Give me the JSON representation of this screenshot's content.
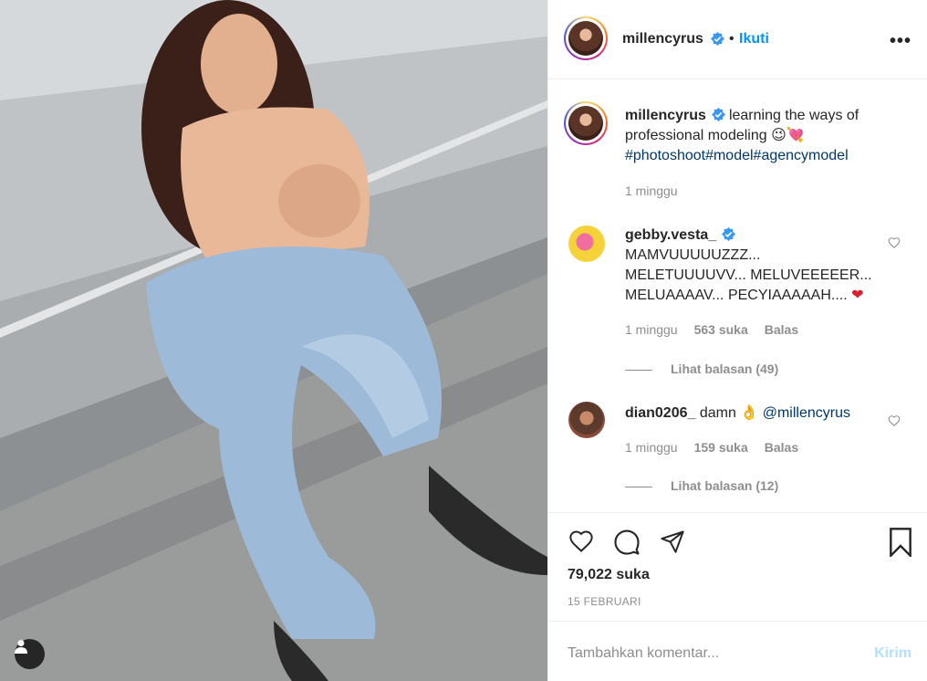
{
  "post": {
    "username": "millencyrus",
    "follow_label": "Ikuti",
    "more_icon": "more-options-icon",
    "separator": "•"
  },
  "caption": {
    "username": "millencyrus",
    "text": "learning the ways of professional modeling",
    "emoji": "😉💘",
    "hashtags": "#photoshoot#model#agencymodel",
    "time": "1 minggu"
  },
  "comments": [
    {
      "username": "gebby.vesta_",
      "verified": true,
      "text": "MAMVUUUUUZZZ... MELETUUUUVV... MELUVEEEEER... MELUAAAAV... PECYIAAAAAH....",
      "line1": "MAMVUUUUUZZZ...",
      "line2": "MELETUUUUVV... MELUVEEEEER...",
      "line3": "MELUAAAAV... PECYIAAAAAH....",
      "emoji": "❤",
      "time": "1 minggu",
      "likes": "563 suka",
      "reply_label": "Balas",
      "view_replies": "Lihat balasan (49)"
    },
    {
      "username": "dian0206_",
      "verified": false,
      "text": "damn",
      "emoji": "👌",
      "mention": "@millencyrus",
      "time": "1 minggu",
      "likes": "159 suka",
      "reply_label": "Balas",
      "view_replies": "Lihat balasan (12)"
    }
  ],
  "actions": {
    "likes": "79,022 suka",
    "date": "15 FEBRUARI"
  },
  "add_comment": {
    "placeholder": "Tambahkan komentar...",
    "send_label": "Kirim"
  },
  "colors": {
    "accent": "#0095f6",
    "hashtag": "#00376b",
    "muted": "#8e8e8e",
    "heart": "#d9202f"
  }
}
